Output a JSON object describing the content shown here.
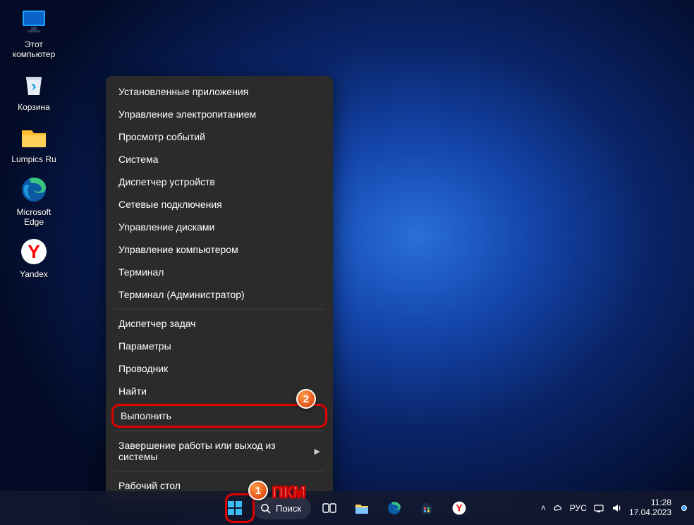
{
  "desktop_icons": [
    {
      "id": "this-pc",
      "label": "Этот\nкомпьютер"
    },
    {
      "id": "recycle",
      "label": "Корзина"
    },
    {
      "id": "lumpics",
      "label": "Lumpics Ru"
    },
    {
      "id": "edge",
      "label": "Microsoft\nEdge"
    },
    {
      "id": "yandex",
      "label": "Yandex"
    }
  ],
  "context_menu": {
    "items": [
      {
        "label": "Установленные приложения"
      },
      {
        "label": "Управление электропитанием"
      },
      {
        "label": "Просмотр событий"
      },
      {
        "label": "Система"
      },
      {
        "label": "Диспетчер устройств"
      },
      {
        "label": "Сетевые подключения"
      },
      {
        "label": "Управление дисками"
      },
      {
        "label": "Управление компьютером"
      },
      {
        "label": "Терминал"
      },
      {
        "label": "Терминал (Администратор)"
      },
      {
        "sep": true
      },
      {
        "label": "Диспетчер задач"
      },
      {
        "label": "Параметры"
      },
      {
        "label": "Проводник"
      },
      {
        "label": "Найти"
      },
      {
        "label": "Выполнить",
        "highlight": true
      },
      {
        "sep": true
      },
      {
        "label": "Завершение работы или выход из системы",
        "submenu": true
      },
      {
        "sep": true
      },
      {
        "label": "Рабочий стол"
      }
    ]
  },
  "annotations": {
    "step1": "1",
    "step2": "2",
    "pkm_text": "ПКМ"
  },
  "taskbar": {
    "search_label": "Поиск",
    "tray": {
      "lang": "РУС",
      "time": "11:28",
      "date": "17.04.2023"
    }
  }
}
